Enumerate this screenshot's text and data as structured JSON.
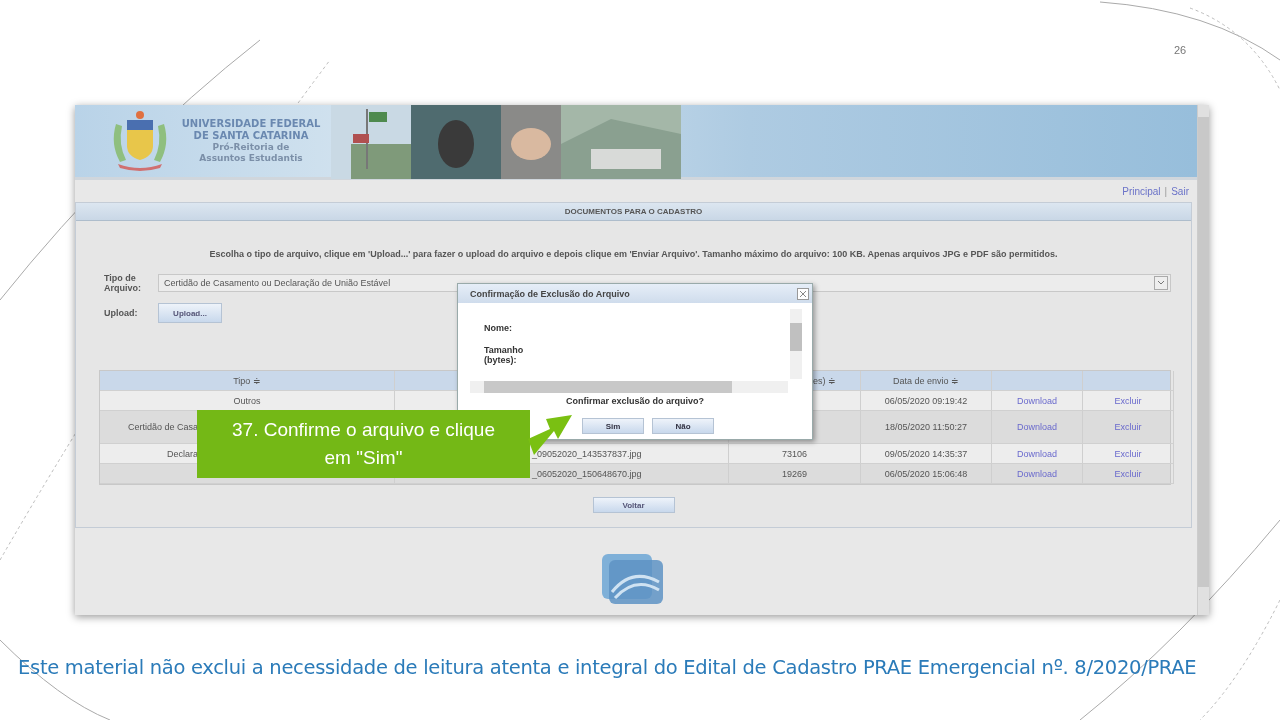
{
  "slide": {
    "page_number": "26",
    "footer": "Este material não exclui a necessidade de leitura atenta e integral do Edital de Cadastro PRAE Emergencial nº. 8/2020/PRAE"
  },
  "header": {
    "title_lines": [
      "UNIVERSIDADE FEDERAL",
      "DE SANTA CATARINA"
    ],
    "subtitle_lines": [
      "Pró-Reitoria de",
      "Assuntos Estudantis"
    ]
  },
  "top_links": {
    "items": [
      "Principal",
      "Sair"
    ],
    "separator": "|"
  },
  "panel": {
    "title": "DOCUMENTOS PARA O CADASTRO",
    "instructions": "Escolha o tipo de arquivo, clique em 'Upload...' para fazer o upload do arquivo e depois clique em 'Enviar Arquivo'. Tamanho máximo do arquivo: 100 KB. Apenas arquivos JPG e PDF são permitidos.",
    "file_type": {
      "label": "Tipo de Arquivo:",
      "value": "Certidão de Casamento ou Declaração de União Estável"
    },
    "upload": {
      "label": "Upload:",
      "button": "Upload..."
    },
    "table": {
      "columns": [
        {
          "label": "Tipo ≑"
        },
        {},
        {
          "label": "es) ≑"
        },
        {
          "label": "Data de envio ≑"
        },
        {},
        {}
      ],
      "rows": [
        {
          "tipo": "Outros",
          "clipped": false,
          "data": "06/05/2020 09:19:42",
          "download": "Download",
          "excluir": "Excluir"
        },
        {
          "tipo": "Certidão de Casa",
          "clipped": true,
          "data": "18/05/2020 11:50:27",
          "download": "Download",
          "excluir": "Excluir"
        },
        {
          "tipo": "Declara",
          "clipped": true,
          "arquivo": "_09052020_143537837.jpg",
          "tamanho": "73106",
          "data": "09/05/2020 14:35:37",
          "download": "Download",
          "excluir": "Excluir"
        },
        {
          "arquivo": "_06052020_150648670.jpg",
          "tamanho": "19269",
          "data": "06/05/2020 15:06:48",
          "download": "Download",
          "excluir": "Excluir"
        }
      ]
    },
    "back_button": "Voltar"
  },
  "dialog": {
    "title": "Confirmação de Exclusão do Arquivo",
    "fields": [
      "Nome:",
      "Tamanho (bytes):"
    ],
    "question": "Confirmar exclusão do arquivo?",
    "buttons": [
      "Sim",
      "Não"
    ]
  },
  "callout": {
    "text": "37. Confirme o arquivo e clique em \"Sim\""
  }
}
